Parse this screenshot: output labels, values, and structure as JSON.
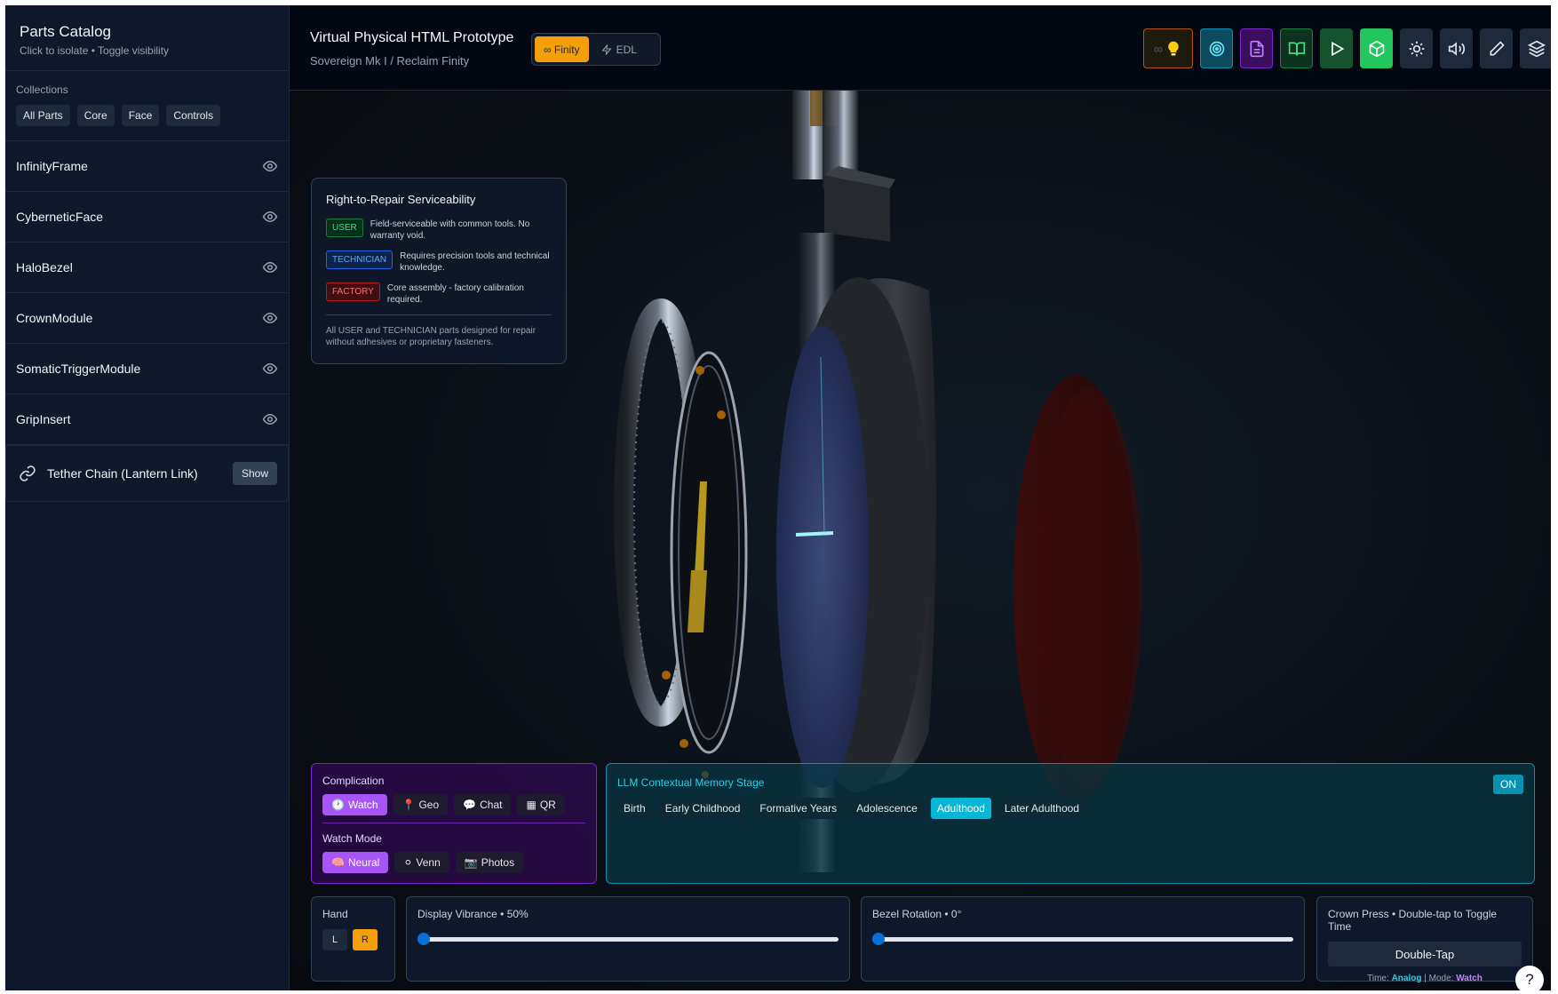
{
  "sidebar": {
    "title": "Parts Catalog",
    "subtitle": "Click to isolate • Toggle visibility",
    "collections_label": "Collections",
    "collections": [
      "All Parts",
      "Core",
      "Face",
      "Controls"
    ],
    "parts": [
      "InfinityFrame",
      "CyberneticFace",
      "HaloBezel",
      "CrownModule",
      "SomaticTriggerModule",
      "GripInsert"
    ],
    "tether": {
      "label": "Tether Chain (Lantern Link)",
      "button": "Show"
    }
  },
  "header": {
    "title": "Virtual Physical HTML Prototype",
    "subtitle": "Sovereign Mk I / Reclaim Finity",
    "modes": [
      {
        "label": "∞ Finity",
        "active": true
      },
      {
        "label": "EDL",
        "active": false
      }
    ],
    "toolbar_icons": [
      "infinity-bulb-icon",
      "target-icon",
      "document-icon",
      "book-icon",
      "play-icon",
      "package-icon",
      "sun-icon",
      "volume-icon",
      "pencil-icon",
      "layers-icon"
    ],
    "toolbar_infinity_glyph": "∞"
  },
  "repair": {
    "title": "Right-to-Repair Serviceability",
    "levels": [
      {
        "badge": "USER",
        "desc": "Field-serviceable with common tools. No warranty void."
      },
      {
        "badge": "TECHNICIAN",
        "desc": "Requires precision tools and technical knowledge."
      },
      {
        "badge": "FACTORY",
        "desc": "Core assembly - factory calibration required."
      }
    ],
    "note": "All USER and TECHNICIAN parts designed for repair without adhesives or proprietary fasteners."
  },
  "complication": {
    "label": "Complication",
    "options": [
      {
        "icon": "🕐",
        "label": "Watch",
        "active": true
      },
      {
        "icon": "📍",
        "label": "Geo",
        "active": false
      },
      {
        "icon": "💬",
        "label": "Chat",
        "active": false
      },
      {
        "icon": "▦",
        "label": "QR",
        "active": false
      }
    ],
    "watch_mode_label": "Watch Mode",
    "watch_modes": [
      {
        "icon": "🧠",
        "label": "Neural",
        "active": true
      },
      {
        "icon": "⚪",
        "label": "Venn",
        "active": false
      },
      {
        "icon": "📷",
        "label": "Photos",
        "active": false
      }
    ]
  },
  "llm": {
    "title": "LLM Contextual Memory Stage",
    "toggle": "ON",
    "stages": [
      "Birth",
      "Early Childhood",
      "Formative Years",
      "Adolescence",
      "Adulthood",
      "Later Adulthood"
    ],
    "active_stage": "Adulthood"
  },
  "controls": {
    "hand_label": "Hand",
    "hand_options": [
      "L",
      "R"
    ],
    "hand_active": "R",
    "vibrance_label": "Display Vibrance • 50%",
    "vibrance_value": 0.5,
    "bezel_label": "Bezel Rotation • 0°",
    "bezel_value": 0,
    "crown_label": "Crown Press • Double-tap to Toggle Time",
    "crown_button": "Double-Tap",
    "crown_time_prefix": "Time:",
    "crown_time_value": "Analog",
    "crown_sep": "|",
    "crown_mode_prefix": "Mode:",
    "crown_mode_value": "Watch"
  },
  "help": "?"
}
